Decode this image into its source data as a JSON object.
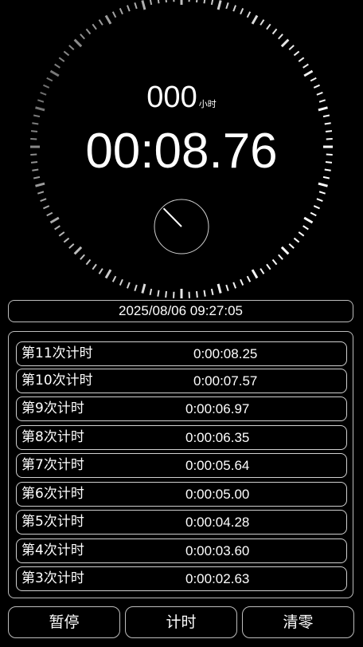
{
  "stopwatch": {
    "hours_value": "000",
    "hours_unit": "小时",
    "elapsed_time": "00:08.76",
    "second_hand_fraction": 0.876
  },
  "datetime": "2025/08/06 09:27:05",
  "laps": [
    {
      "label": "第11次计时",
      "time": "0:00:08.25"
    },
    {
      "label": "第10次计时",
      "time": "0:00:07.57"
    },
    {
      "label": "第9次计时",
      "time": "0:00:06.97"
    },
    {
      "label": "第8次计时",
      "time": "0:00:06.35"
    },
    {
      "label": "第7次计时",
      "time": "0:00:05.64"
    },
    {
      "label": "第6次计时",
      "time": "0:00:05.00"
    },
    {
      "label": "第5次计时",
      "time": "0:00:04.28"
    },
    {
      "label": "第4次计时",
      "time": "0:00:03.60"
    },
    {
      "label": "第3次计时",
      "time": "0:00:02.63"
    }
  ],
  "buttons": {
    "pause": "暂停",
    "lap": "计时",
    "reset": "清零"
  }
}
